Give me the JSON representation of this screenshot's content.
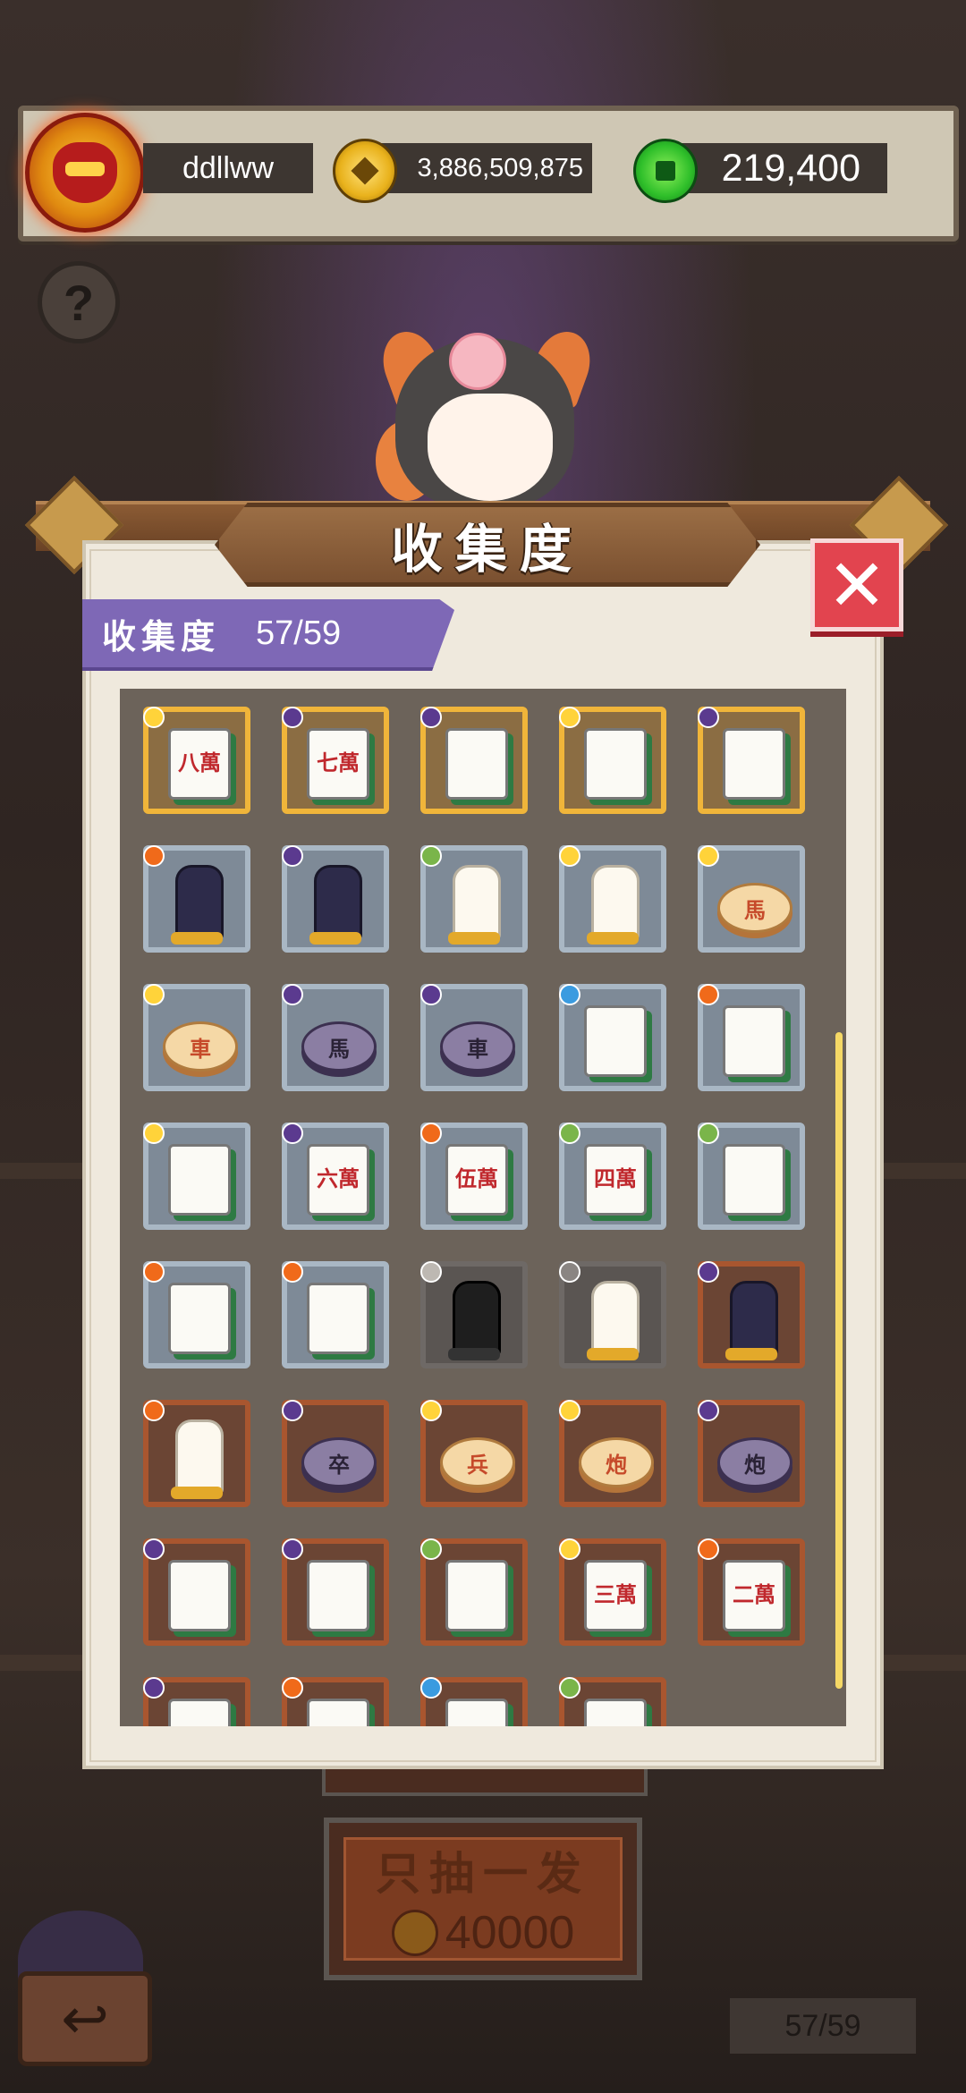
{
  "player": {
    "name": "ddllww",
    "gold": "3,886,509,875",
    "jade": "219,400"
  },
  "panel": {
    "title": "收集度",
    "progress_label": "收集度",
    "progress_value": "57/59",
    "close_symbol": "✕"
  },
  "help_symbol": "?",
  "colors": {
    "gold_frame": "#f0b53a",
    "blue_frame": "#a9b7c4",
    "brown_frame": "#a9562f",
    "ribbon": "#7e68b6",
    "close": "#e2444f",
    "scrollbar": "#f5d865"
  },
  "items": [
    {
      "frame": "gold",
      "badge": "sun",
      "kind": "tile",
      "text": "八萬",
      "color": "red"
    },
    {
      "frame": "gold",
      "badge": "moon",
      "kind": "tile",
      "text": "七萬",
      "color": "red"
    },
    {
      "frame": "gold",
      "badge": "moon",
      "kind": "tile",
      "text": "",
      "color": "blue"
    },
    {
      "frame": "gold",
      "badge": "sun",
      "kind": "tile",
      "text": "",
      "color": "blue"
    },
    {
      "frame": "gold",
      "badge": "moon",
      "kind": "tile",
      "text": "",
      "color": "green"
    },
    {
      "frame": "blue",
      "badge": "fire",
      "kind": "chess",
      "style": "dark"
    },
    {
      "frame": "blue",
      "badge": "moon",
      "kind": "chess",
      "style": "dark"
    },
    {
      "frame": "blue",
      "badge": "leaf",
      "kind": "chess",
      "style": "light"
    },
    {
      "frame": "blue",
      "badge": "sun",
      "kind": "chess",
      "style": "light"
    },
    {
      "frame": "blue",
      "badge": "sun",
      "kind": "disc",
      "text": "馬",
      "style": "cream"
    },
    {
      "frame": "blue",
      "badge": "sun",
      "kind": "disc",
      "text": "車",
      "style": "cream"
    },
    {
      "frame": "blue",
      "badge": "moon",
      "kind": "disc",
      "text": "馬",
      "style": "purple"
    },
    {
      "frame": "blue",
      "badge": "moon",
      "kind": "disc",
      "text": "車",
      "style": "purple"
    },
    {
      "frame": "blue",
      "badge": "water",
      "kind": "tile",
      "text": "",
      "color": "green"
    },
    {
      "frame": "blue",
      "badge": "fire",
      "kind": "tile",
      "text": "",
      "color": "green"
    },
    {
      "frame": "blue",
      "badge": "sun",
      "kind": "tile",
      "text": "",
      "color": "green"
    },
    {
      "frame": "blue",
      "badge": "moon",
      "kind": "tile",
      "text": "六萬",
      "color": "red"
    },
    {
      "frame": "blue",
      "badge": "fire",
      "kind": "tile",
      "text": "伍萬",
      "color": "red"
    },
    {
      "frame": "blue",
      "badge": "leaf",
      "kind": "tile",
      "text": "四萬",
      "color": "red"
    },
    {
      "frame": "blue",
      "badge": "leaf",
      "kind": "tile",
      "text": "",
      "color": "red"
    },
    {
      "frame": "blue",
      "badge": "fire",
      "kind": "tile",
      "text": "",
      "color": "green"
    },
    {
      "frame": "blue",
      "badge": "fire",
      "kind": "tile",
      "text": "",
      "color": "blue"
    },
    {
      "frame": "gray",
      "badge": "mtn",
      "kind": "chess",
      "style": "black"
    },
    {
      "frame": "gray",
      "badge": "grey",
      "kind": "chess",
      "style": "light"
    },
    {
      "frame": "brown",
      "badge": "moon",
      "kind": "chess",
      "style": "dark"
    },
    {
      "frame": "brown",
      "badge": "fire",
      "kind": "chess",
      "style": "light"
    },
    {
      "frame": "brown",
      "badge": "moon",
      "kind": "disc",
      "text": "卒",
      "style": "purple"
    },
    {
      "frame": "brown",
      "badge": "sun",
      "kind": "disc",
      "text": "兵",
      "style": "cream"
    },
    {
      "frame": "brown",
      "badge": "sun",
      "kind": "disc",
      "text": "炮",
      "style": "cream"
    },
    {
      "frame": "brown",
      "badge": "moon",
      "kind": "disc",
      "text": "炮",
      "style": "purple"
    },
    {
      "frame": "brown",
      "badge": "moon",
      "kind": "tile",
      "text": "",
      "color": "green"
    },
    {
      "frame": "brown",
      "badge": "moon",
      "kind": "tile",
      "text": "",
      "color": "green"
    },
    {
      "frame": "brown",
      "badge": "leaf",
      "kind": "tile",
      "text": "",
      "color": "green"
    },
    {
      "frame": "brown",
      "badge": "sun",
      "kind": "tile",
      "text": "三萬",
      "color": "red"
    },
    {
      "frame": "brown",
      "badge": "fire",
      "kind": "tile",
      "text": "二萬",
      "color": "red"
    },
    {
      "frame": "brown",
      "badge": "moon",
      "kind": "tile",
      "text": "",
      "color": "red"
    },
    {
      "frame": "brown",
      "badge": "fire",
      "kind": "tile",
      "text": "",
      "color": "blue"
    },
    {
      "frame": "brown",
      "badge": "water",
      "kind": "tile",
      "text": "",
      "color": "blue"
    },
    {
      "frame": "brown",
      "badge": "leaf",
      "kind": "tile",
      "text": "",
      "color": "blue"
    }
  ],
  "draw": {
    "label": "只抽一发",
    "cost": "40000"
  },
  "bottom": {
    "back_symbol": "↩",
    "counter": "57/59"
  }
}
